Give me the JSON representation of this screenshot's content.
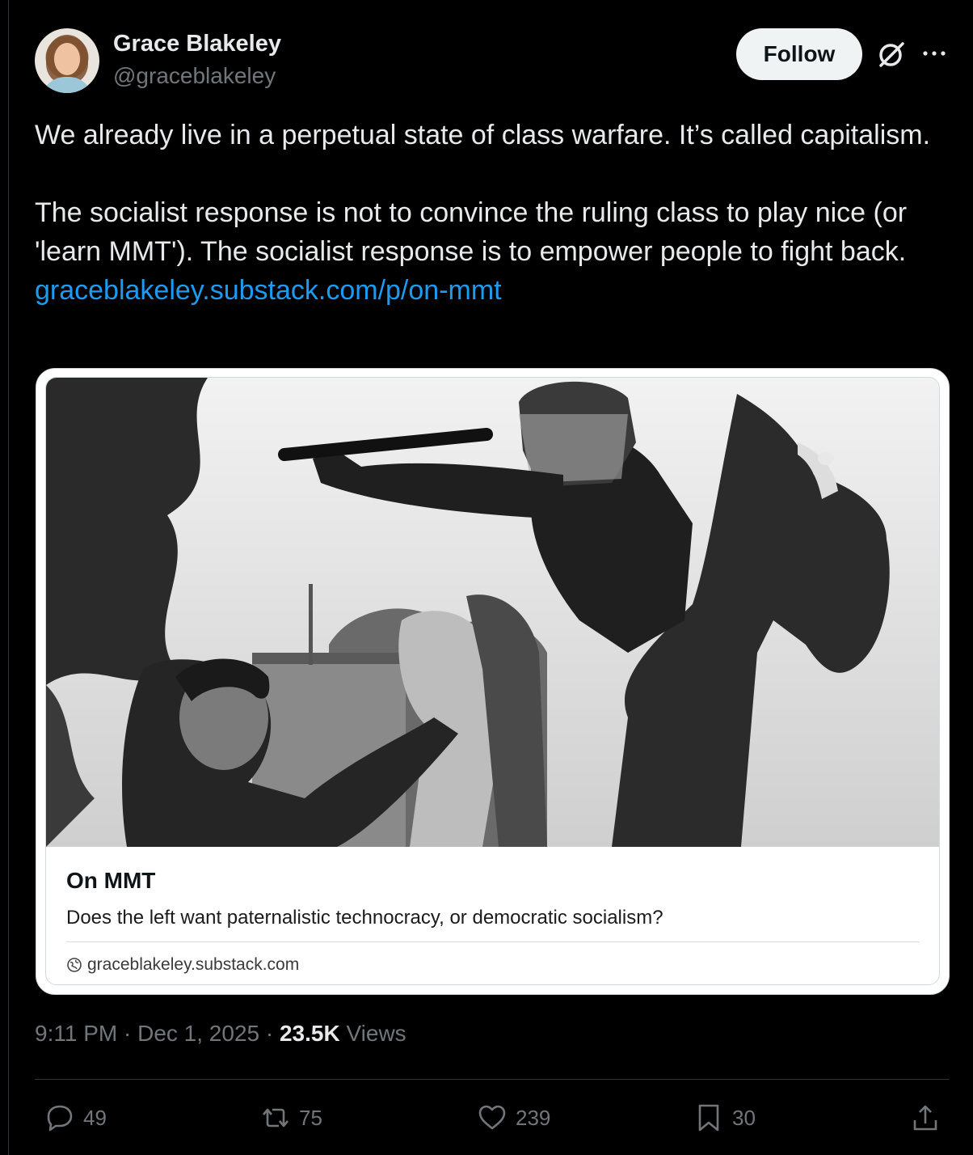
{
  "author": {
    "name": "Grace Blakeley",
    "handle": "@graceblakeley",
    "follow_label": "Follow"
  },
  "tweet": {
    "paragraph1": "We already live in a perpetual state of class warfare. It’s called capitalism.",
    "paragraph2": "The socialist response is not to convince the ruling class to play nice (or 'learn MMT'). The socialist response is to empower people to fight back.",
    "link_text": "graceblakeley.substack.com/p/on-mmt"
  },
  "card": {
    "title": "On MMT",
    "description": "Does the left want paternalistic technocracy, or democratic socialism?",
    "domain": "graceblakeley.substack.com",
    "image_icon": "photo"
  },
  "meta": {
    "time": "9:11 PM",
    "separator": "·",
    "date": "Dec 1, 2025",
    "views_count": "23.5K",
    "views_label": "Views"
  },
  "actions": {
    "replies": "49",
    "reposts": "75",
    "likes": "239",
    "bookmarks": "30"
  },
  "icons": {
    "top_right": [
      "grok-icon",
      "more-icon"
    ],
    "actions": [
      "reply-icon",
      "repost-icon",
      "like-icon",
      "bookmark-icon",
      "share-icon"
    ]
  },
  "colors": {
    "background": "#000000",
    "text": "#e7e9ea",
    "muted": "#71767b",
    "link": "#1d9bf0"
  }
}
